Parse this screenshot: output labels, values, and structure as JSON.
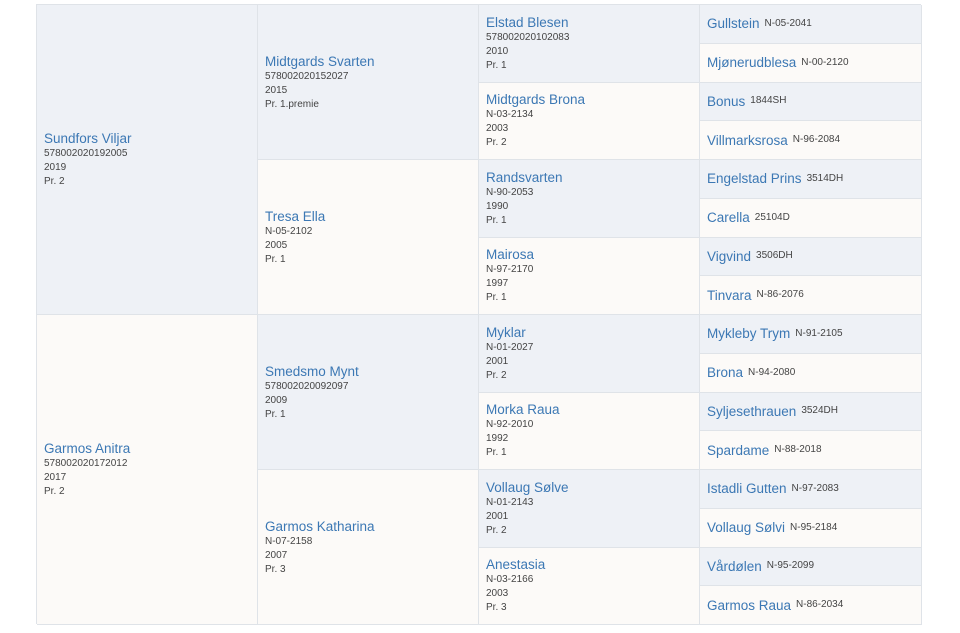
{
  "gen1": [
    {
      "name": "Sundfors Viljar",
      "reg": "578002020192005",
      "year": "2019",
      "prize": "Pr. 2"
    },
    {
      "name": "Garmos Anitra",
      "reg": "578002020172012",
      "year": "2017",
      "prize": "Pr. 2"
    }
  ],
  "gen2": [
    {
      "name": "Midtgards Svarten",
      "reg": "578002020152027",
      "year": "2015",
      "prize": "Pr. 1.premie"
    },
    {
      "name": "Tresa Ella",
      "reg": "N-05-2102",
      "year": "2005",
      "prize": "Pr. 1"
    },
    {
      "name": "Smedsmo Mynt",
      "reg": "578002020092097",
      "year": "2009",
      "prize": "Pr. 1"
    },
    {
      "name": "Garmos Katharina",
      "reg": "N-07-2158",
      "year": "2007",
      "prize": "Pr. 3"
    }
  ],
  "gen3": [
    {
      "name": "Elstad Blesen",
      "reg": "578002020102083",
      "year": "2010",
      "prize": "Pr. 1"
    },
    {
      "name": "Midtgards Brona",
      "reg": "N-03-2134",
      "year": "2003",
      "prize": "Pr. 2"
    },
    {
      "name": "Randsvarten",
      "reg": "N-90-2053",
      "year": "1990",
      "prize": "Pr. 1"
    },
    {
      "name": "Mairosa",
      "reg": "N-97-2170",
      "year": "1997",
      "prize": "Pr. 1"
    },
    {
      "name": "Myklar",
      "reg": "N-01-2027",
      "year": "2001",
      "prize": "Pr. 2"
    },
    {
      "name": "Morka Raua",
      "reg": "N-92-2010",
      "year": "1992",
      "prize": "Pr. 1"
    },
    {
      "name": "Vollaug Sølve",
      "reg": "N-01-2143",
      "year": "2001",
      "prize": "Pr. 2"
    },
    {
      "name": "Anestasia",
      "reg": "N-03-2166",
      "year": "2003",
      "prize": "Pr. 3"
    }
  ],
  "gen4": [
    {
      "name": "Gullstein",
      "reg": "N-05-2041"
    },
    {
      "name": "Mjønerudblesa",
      "reg": "N-00-2120"
    },
    {
      "name": "Bonus",
      "reg": "1844SH"
    },
    {
      "name": "Villmarksrosa",
      "reg": "N-96-2084"
    },
    {
      "name": "Engelstad Prins",
      "reg": "3514DH"
    },
    {
      "name": "Carella",
      "reg": "25104D"
    },
    {
      "name": "Vigvind",
      "reg": "3506DH"
    },
    {
      "name": "Tinvara",
      "reg": "N-86-2076"
    },
    {
      "name": "Mykleby Trym",
      "reg": "N-91-2105"
    },
    {
      "name": "Brona",
      "reg": "N-94-2080"
    },
    {
      "name": "Syljesethrauen",
      "reg": "3524DH"
    },
    {
      "name": "Spardame",
      "reg": "N-88-2018"
    },
    {
      "name": "Istadli Gutten",
      "reg": "N-97-2083"
    },
    {
      "name": "Vollaug Sølvi",
      "reg": "N-95-2184"
    },
    {
      "name": "Vårdølen",
      "reg": "N-95-2099"
    },
    {
      "name": "Garmos Raua",
      "reg": "N-86-2034"
    }
  ]
}
